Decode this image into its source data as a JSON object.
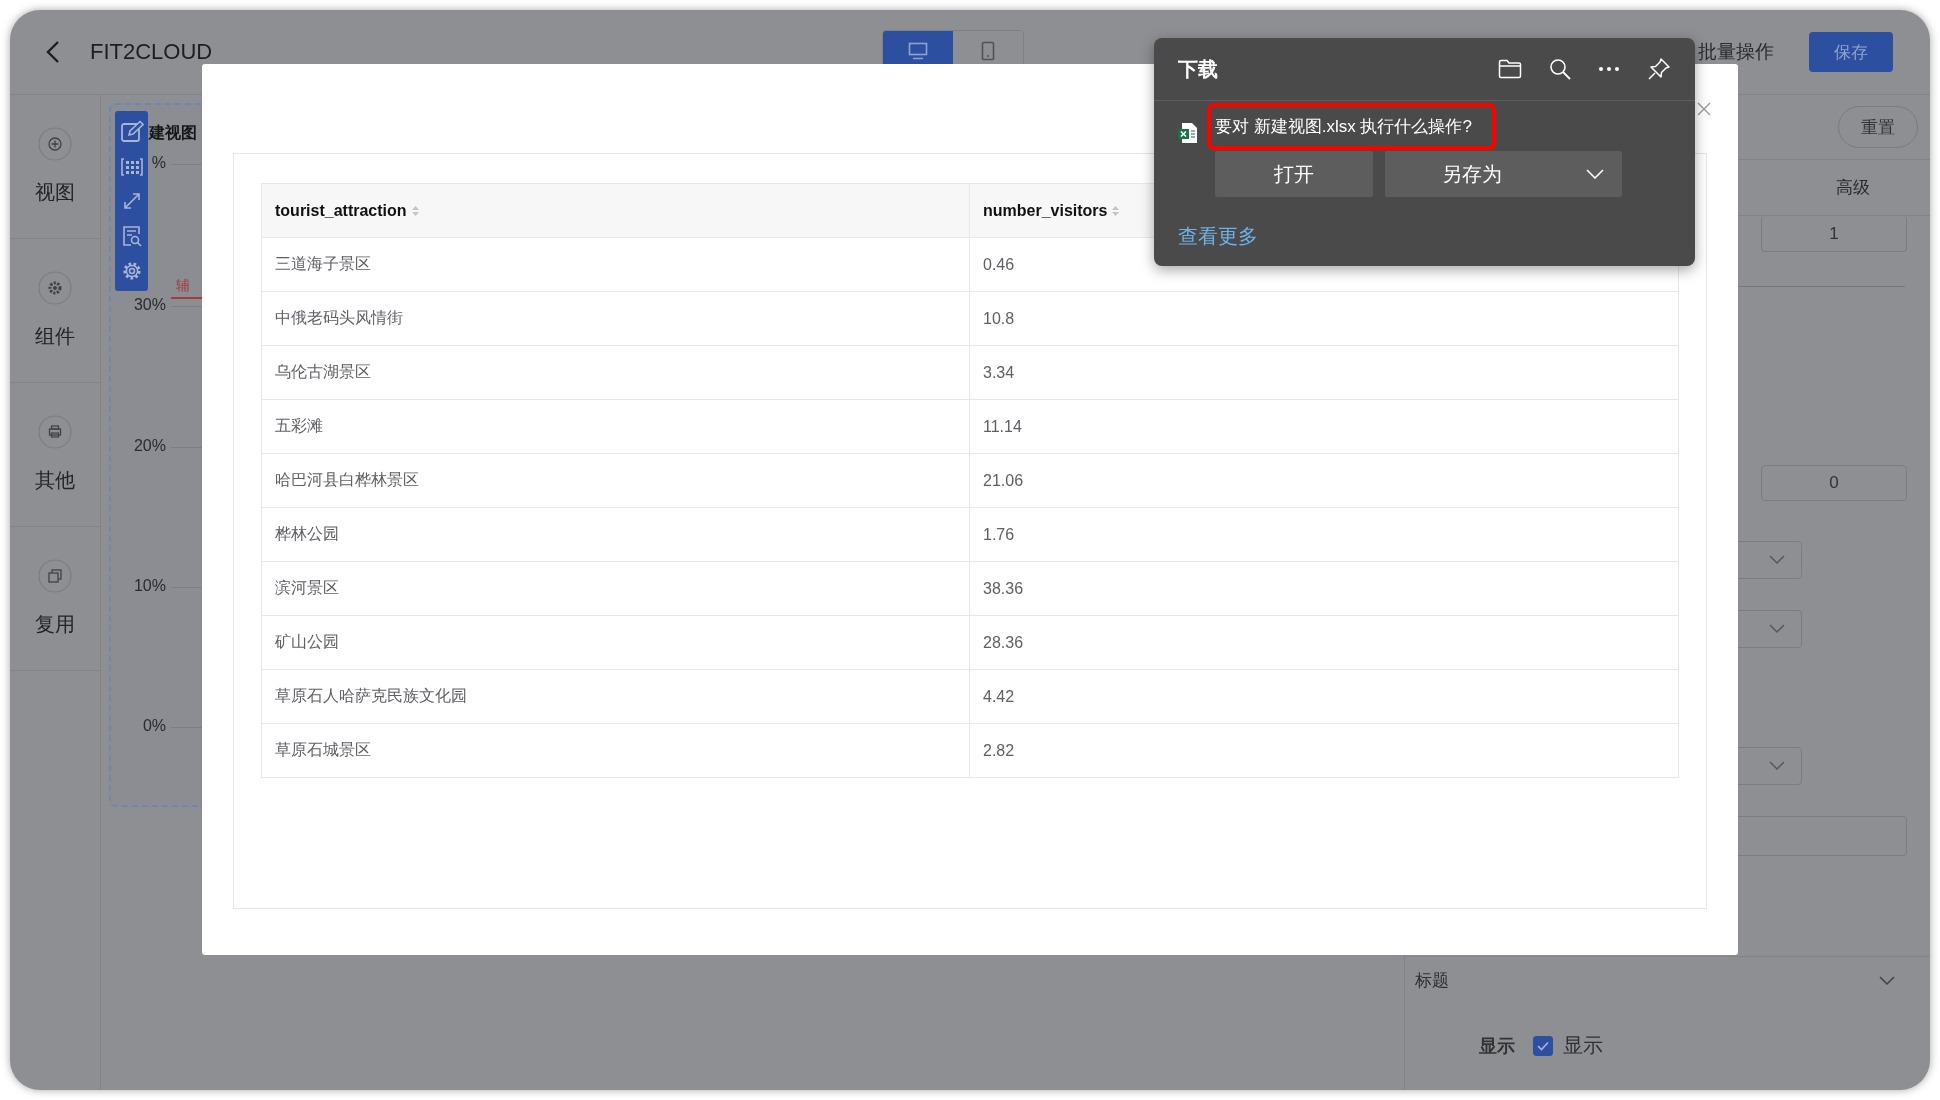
{
  "header": {
    "title": "FIT2CLOUD",
    "view_toggle": [
      {
        "kind": "desktop",
        "selected": true
      },
      {
        "kind": "mobile",
        "selected": false
      }
    ],
    "batch_action": "批量操作",
    "save": "保存"
  },
  "sidebar": {
    "items": [
      {
        "kind": "add",
        "label": "视图"
      },
      {
        "kind": "gear",
        "label": "组件"
      },
      {
        "kind": "printer",
        "label": "其他"
      },
      {
        "kind": "copy",
        "label": "复用"
      }
    ]
  },
  "canvas": {
    "chart_title": "建视图",
    "y_labels": [
      "%",
      "30%",
      "20%",
      "10%",
      "0%"
    ],
    "reference_label": "辅"
  },
  "right_panel": {
    "reset": "重置",
    "tab": "高级",
    "inputs": [
      "1",
      "0"
    ],
    "title_section": {
      "label": "标题",
      "show_label": "显示",
      "checkbox": {
        "label": "显示",
        "checked": true
      }
    }
  },
  "modal": {
    "table": {
      "columns": [
        "tourist_attraction",
        "number_visitors"
      ],
      "rows": [
        [
          "三道海子景区",
          "0.46"
        ],
        [
          "中俄老码头风情街",
          "10.8"
        ],
        [
          "乌伦古湖景区",
          "3.34"
        ],
        [
          "五彩滩",
          "11.14"
        ],
        [
          "哈巴河县白桦林景区",
          "21.06"
        ],
        [
          "桦林公园",
          "1.76"
        ],
        [
          "滨河景区",
          "38.36"
        ],
        [
          "矿山公园",
          "28.36"
        ],
        [
          "草原石人哈萨克民族文化园",
          "4.42"
        ],
        [
          "草原石城景区",
          "2.82"
        ]
      ]
    }
  },
  "download": {
    "title": "下载",
    "prompt": "要对 新建视图.xlsx 执行什么操作?",
    "highlighted": true,
    "open": "打开",
    "save_as": "另存为",
    "more": "查看更多"
  }
}
